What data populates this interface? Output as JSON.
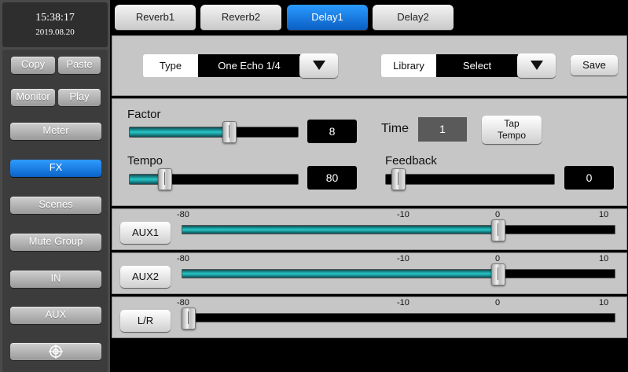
{
  "clock": {
    "time": "15:38:17",
    "date": "2019.08.20"
  },
  "sidebar": {
    "copy": "Copy",
    "paste": "Paste",
    "monitor": "Monitor",
    "play": "Play",
    "meter": "Meter",
    "fx": "FX",
    "scenes": "Scenes",
    "mute_group": "Mute Group",
    "in": "IN",
    "aux": "AUX"
  },
  "tabs": [
    "Reverb1",
    "Reverb2",
    "Delay1",
    "Delay2"
  ],
  "active_tab": "Delay1",
  "header": {
    "type_label": "Type",
    "type_value": "One Echo 1/4",
    "library_label": "Library",
    "library_value": "Select",
    "save": "Save"
  },
  "params": {
    "factor_label": "Factor",
    "factor_value": "8",
    "factor_level": 0.59,
    "tempo_label": "Tempo",
    "tempo_value": "80",
    "tempo_level": 0.21,
    "time_label": "Time",
    "time_value": "1",
    "tap_tempo": "Tap\nTempo",
    "feedback_label": "Feedback",
    "feedback_value": "0",
    "feedback_level": 0.0
  },
  "scale_labels": [
    "-80",
    "-10",
    "0",
    "10"
  ],
  "aux_rows": [
    {
      "name": "AUX1",
      "level": 0.733
    },
    {
      "name": "AUX2",
      "level": 0.733
    },
    {
      "name": "L/R",
      "level": 0.0
    }
  ],
  "colors": {
    "accent": "#0b74e6",
    "fill": "#25c7c7",
    "panel": "#c6c6c6"
  }
}
